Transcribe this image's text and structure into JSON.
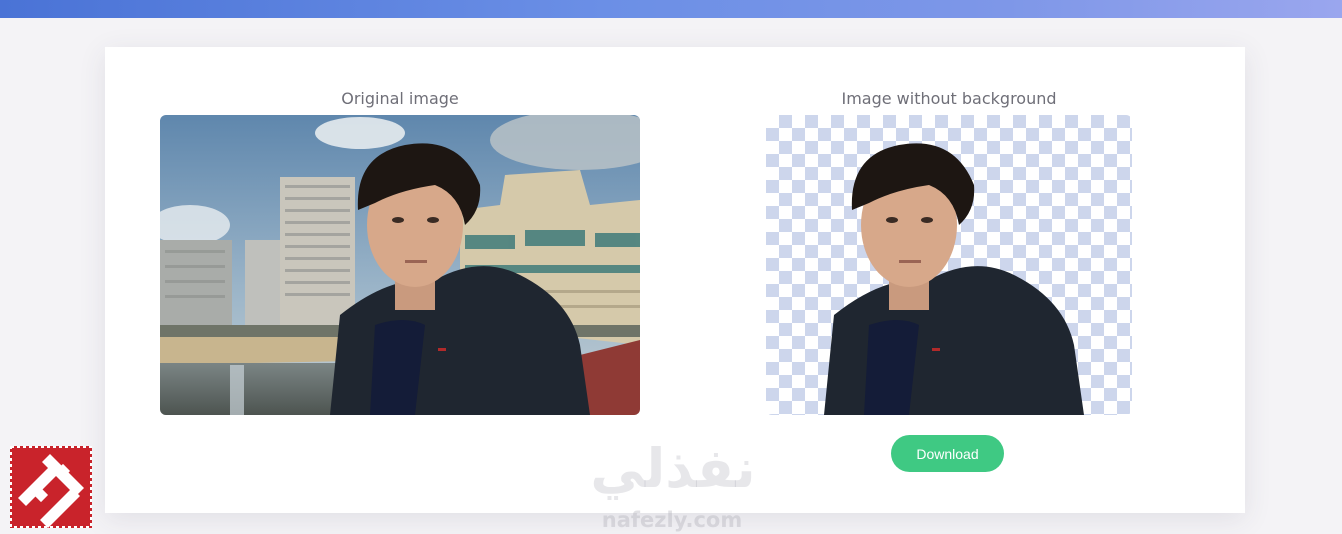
{
  "panels": {
    "original_title": "Original image",
    "result_title": "Image without background"
  },
  "actions": {
    "download_label": "Download"
  },
  "watermark": {
    "arabic": "نفذلي",
    "latin": "nafezly.com"
  },
  "colors": {
    "top_bar": "#6b8fe6",
    "download_button": "#3fc983",
    "checker": "#cdd6ec",
    "logo": "#c9232b"
  },
  "icons": {
    "logo": "stamp-logo-icon"
  }
}
